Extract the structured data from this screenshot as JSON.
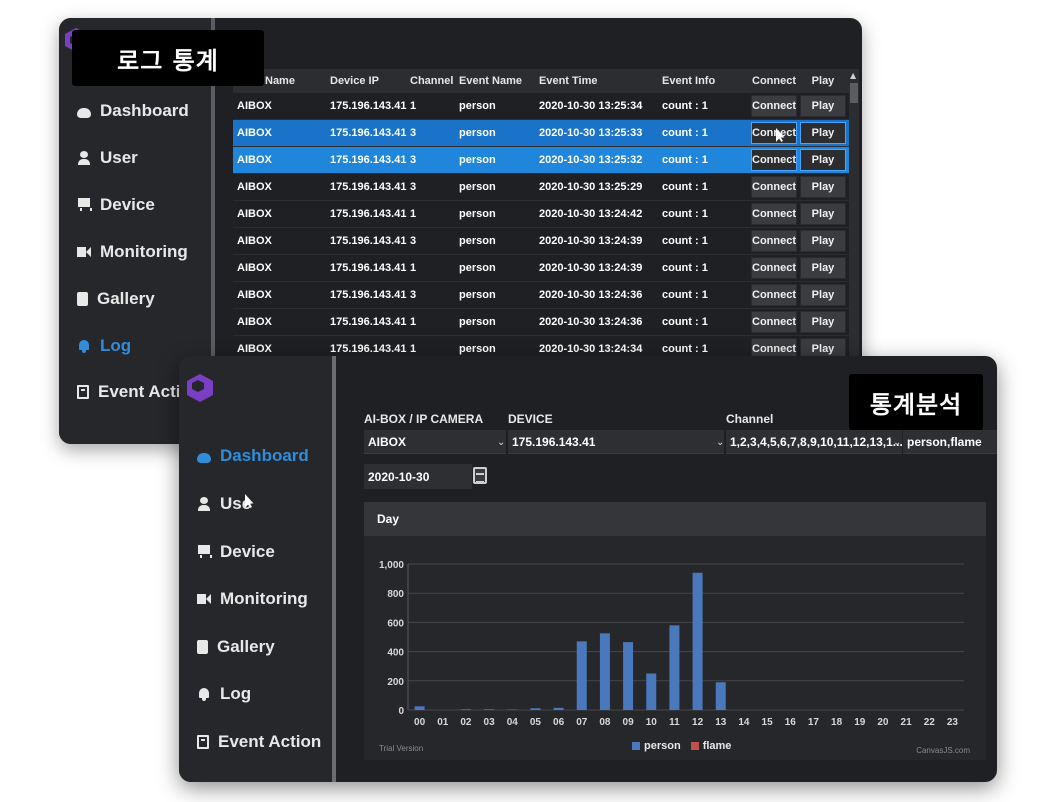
{
  "badges": {
    "log_title": "로그 통계",
    "stats_title": "통계분석"
  },
  "nav": {
    "dashboard": "Dashboard",
    "user": "User",
    "user_partial": "Use",
    "device": "Device",
    "monitoring": "Monitoring",
    "gallery": "Gallery",
    "log": "Log",
    "event_action": "Event Action",
    "event_action_partial": "Event Actio"
  },
  "log_table": {
    "headers": {
      "name": "Name",
      "ip": "Device IP",
      "channel": "Channel",
      "event_name": "Event Name",
      "event_time": "Event Time",
      "event_info": "Event Info",
      "connect": "Connect",
      "play": "Play"
    },
    "connect_label": "Connect",
    "play_label": "Play",
    "rows": [
      {
        "name": "AIBOX",
        "ip": "175.196.143.41",
        "channel": "1",
        "event_name": "person",
        "event_time": "2020-10-30 13:25:34",
        "event_info": "count : 1"
      },
      {
        "name": "AIBOX",
        "ip": "175.196.143.41",
        "channel": "3",
        "event_name": "person",
        "event_time": "2020-10-30 13:25:33",
        "event_info": "count : 1"
      },
      {
        "name": "AIBOX",
        "ip": "175.196.143.41",
        "channel": "3",
        "event_name": "person",
        "event_time": "2020-10-30 13:25:32",
        "event_info": "count : 1"
      },
      {
        "name": "AIBOX",
        "ip": "175.196.143.41",
        "channel": "3",
        "event_name": "person",
        "event_time": "2020-10-30 13:25:29",
        "event_info": "count : 1"
      },
      {
        "name": "AIBOX",
        "ip": "175.196.143.41",
        "channel": "1",
        "event_name": "person",
        "event_time": "2020-10-30 13:24:42",
        "event_info": "count : 1"
      },
      {
        "name": "AIBOX",
        "ip": "175.196.143.41",
        "channel": "3",
        "event_name": "person",
        "event_time": "2020-10-30 13:24:39",
        "event_info": "count : 1"
      },
      {
        "name": "AIBOX",
        "ip": "175.196.143.41",
        "channel": "1",
        "event_name": "person",
        "event_time": "2020-10-30 13:24:39",
        "event_info": "count : 1"
      },
      {
        "name": "AIBOX",
        "ip": "175.196.143.41",
        "channel": "3",
        "event_name": "person",
        "event_time": "2020-10-30 13:24:36",
        "event_info": "count : 1"
      },
      {
        "name": "AIBOX",
        "ip": "175.196.143.41",
        "channel": "1",
        "event_name": "person",
        "event_time": "2020-10-30 13:24:36",
        "event_info": "count : 1"
      },
      {
        "name": "AIBOX",
        "ip": "175.196.143.41",
        "channel": "1",
        "event_name": "person",
        "event_time": "2020-10-30 13:24:34",
        "event_info": "count : 1"
      }
    ]
  },
  "filters": {
    "aibox_label": "AI-BOX / IP CAMERA",
    "aibox_value": "AIBOX",
    "device_label": "DEVICE",
    "device_value": "175.196.143.41",
    "channel_label": "Channel",
    "channel_value": "1,2,3,4,5,6,7,8,9,10,11,12,13,1...",
    "event_value": "person,flame",
    "date_value": "2020-10-30"
  },
  "chart_panel": {
    "header": "Day",
    "trial": "Trial Version",
    "credit": "CanvasJS.com"
  },
  "colors": {
    "person": "#4a78bd",
    "flame": "#c0504d",
    "accent": "#2f8ddc"
  },
  "chart_data": {
    "type": "bar",
    "categories": [
      "00",
      "01",
      "02",
      "03",
      "04",
      "05",
      "06",
      "07",
      "08",
      "09",
      "10",
      "11",
      "12",
      "13",
      "14",
      "15",
      "16",
      "17",
      "18",
      "19",
      "20",
      "21",
      "22",
      "23"
    ],
    "series": [
      {
        "name": "person",
        "values": [
          25,
          0,
          5,
          5,
          3,
          12,
          15,
          470,
          525,
          465,
          250,
          580,
          940,
          190,
          0,
          0,
          0,
          0,
          0,
          0,
          0,
          0,
          0,
          0
        ]
      },
      {
        "name": "flame",
        "values": [
          0,
          0,
          0,
          0,
          0,
          0,
          0,
          0,
          0,
          0,
          0,
          0,
          0,
          0,
          0,
          0,
          0,
          0,
          0,
          0,
          0,
          0,
          0,
          0
        ]
      }
    ],
    "yticks": [
      "0",
      "200",
      "400",
      "600",
      "800",
      "1,000"
    ],
    "ylim": [
      0,
      1000
    ],
    "grid": true,
    "legend": "bottom-center"
  }
}
